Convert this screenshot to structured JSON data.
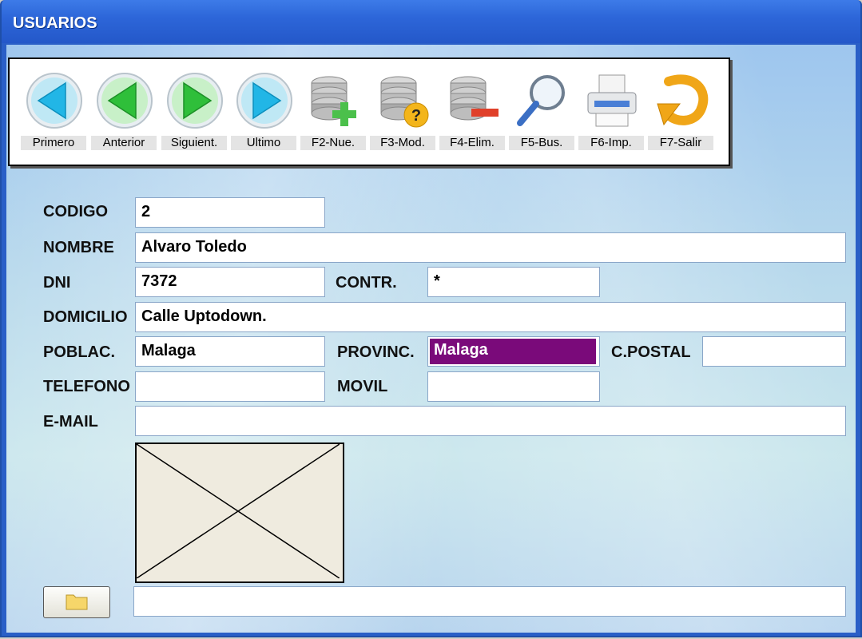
{
  "window": {
    "title": "USUARIOS"
  },
  "toolbar": {
    "buttons": [
      {
        "label": "Primero",
        "icon": "arrow-left-cyan-icon"
      },
      {
        "label": "Anterior",
        "icon": "arrow-left-green-icon"
      },
      {
        "label": "Siguient.",
        "icon": "arrow-right-green-icon"
      },
      {
        "label": "Ultimo",
        "icon": "arrow-right-cyan-icon"
      },
      {
        "label": "F2-Nue.",
        "icon": "database-add-icon"
      },
      {
        "label": "F3-Mod.",
        "icon": "database-question-icon"
      },
      {
        "label": "F4-Elim.",
        "icon": "database-remove-icon"
      },
      {
        "label": "F5-Bus.",
        "icon": "magnifier-icon"
      },
      {
        "label": "F6-Imp.",
        "icon": "printer-icon"
      },
      {
        "label": "F7-Salir",
        "icon": "exit-arrow-icon"
      }
    ]
  },
  "form": {
    "codigo": {
      "label": "CODIGO",
      "value": "2"
    },
    "nombre": {
      "label": "NOMBRE",
      "value": "Alvaro Toledo"
    },
    "dni": {
      "label": "DNI",
      "value": "7372"
    },
    "contr": {
      "label": "CONTR.",
      "value": "*"
    },
    "domicilio": {
      "label": "DOMICILIO",
      "value": "Calle Uptodown."
    },
    "poblac": {
      "label": "POBLAC.",
      "value": "Malaga"
    },
    "provinc": {
      "label": "PROVINC.",
      "value": "Malaga"
    },
    "cpostal": {
      "label": "C.POSTAL",
      "value": ""
    },
    "telefono": {
      "label": "TELEFONO",
      "value": ""
    },
    "movil": {
      "label": "MOVIL",
      "value": ""
    },
    "email": {
      "label": "E-MAIL",
      "value": ""
    },
    "photo_path": {
      "value": ""
    }
  },
  "colors": {
    "title_bar": "#2d66d9",
    "selection": "#7a0a7a"
  }
}
